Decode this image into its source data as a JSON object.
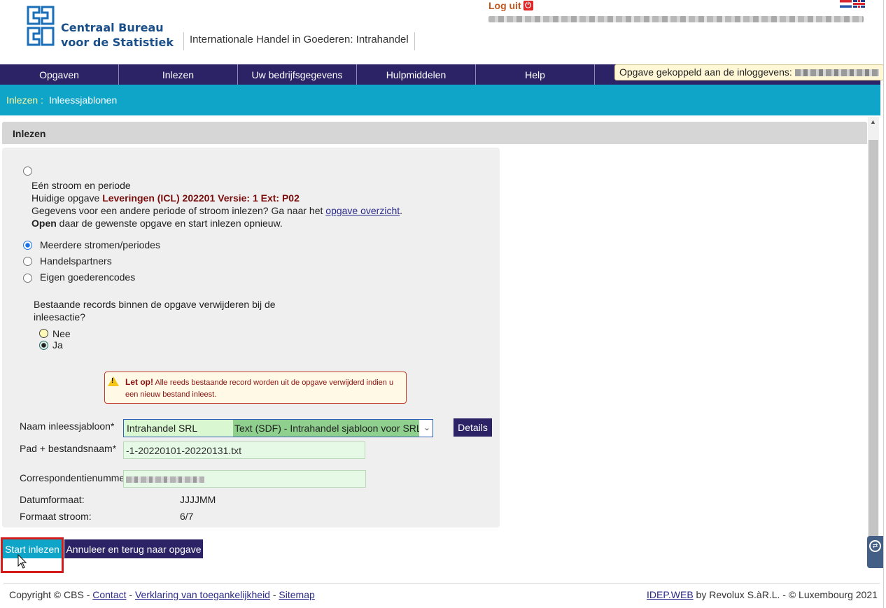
{
  "header": {
    "org_line1": "Centraal Bureau",
    "org_line2": "voor de Statistiek",
    "app_title": "Internationale Handel in Goederen: Intrahandel",
    "logout_label": "Log uit"
  },
  "nav": {
    "items": [
      "Opgaven",
      "Inlezen",
      "Uw bedrijfsgegevens",
      "Hulpmiddelen",
      "Help"
    ],
    "coupled_label": "Opgave gekoppeld aan de inloggevens:"
  },
  "breadcrumb": {
    "section": "Inlezen :",
    "page": "Inleessjablonen"
  },
  "panel": {
    "title": "Inlezen",
    "single_stream_label": "Eén stroom en periode",
    "current_prefix": "Huidige opgave",
    "current_value": "Leveringen (ICL) 202201 Versie: 1 Ext: P02",
    "other_period_text": "Gegevens voor een andere periode of stroom inlezen? Ga naar het",
    "overview_link": "opgave overzicht",
    "open_bold": "Open",
    "open_rest": "daar de gewenste opgave en start inlezen opnieuw.",
    "option_multi": "Meerdere stromen/periodes",
    "option_partners": "Handelspartners",
    "option_codes": "Eigen goederencodes",
    "delete_question_line1": "Bestaande records binnen de opgave verwijderen bij de",
    "delete_question_line2": "inleesactie?",
    "option_no": "Nee",
    "option_yes": "Ja"
  },
  "warning": {
    "title": "Let op!",
    "text": "Alle reeds bestaande record worden uit de opgave verwijderd indien u een nieuw bestand inleest."
  },
  "form": {
    "template_label": "Naam inleessjabloon*",
    "template_name": "Intrahandel SRL",
    "template_desc": "Text (SDF) - Intrahandel sjabloon voor SRL",
    "details_button": "Details",
    "path_label": "Pad + bestandsnaam*",
    "path_value": "-1-20220101-20220131.txt",
    "corr_label": "Correspondentienummer",
    "date_format_label": "Datumformaat:",
    "date_format_value": "JJJJMM",
    "stream_format_label": "Formaat stroom:",
    "stream_format_value": "6/7"
  },
  "actions": {
    "start": "Start inlezen",
    "cancel": "Annuleer en terug naar opgave"
  },
  "footer": {
    "copyright": "Copyright © CBS -",
    "contact": "Contact",
    "sep": "-",
    "accessibility": "Verklaring van toegankelijkheid",
    "sitemap": "Sitemap",
    "idep": "IDEP.WEB",
    "vendor": "by Revolux S.àR.L. - © Luxembourg 2021"
  },
  "colors": {
    "nav_bg": "#2b2366",
    "subbar_bg": "#0ea5c9",
    "logo_blue": "#1a4f8a",
    "highlight_red": "#d41c1c"
  }
}
